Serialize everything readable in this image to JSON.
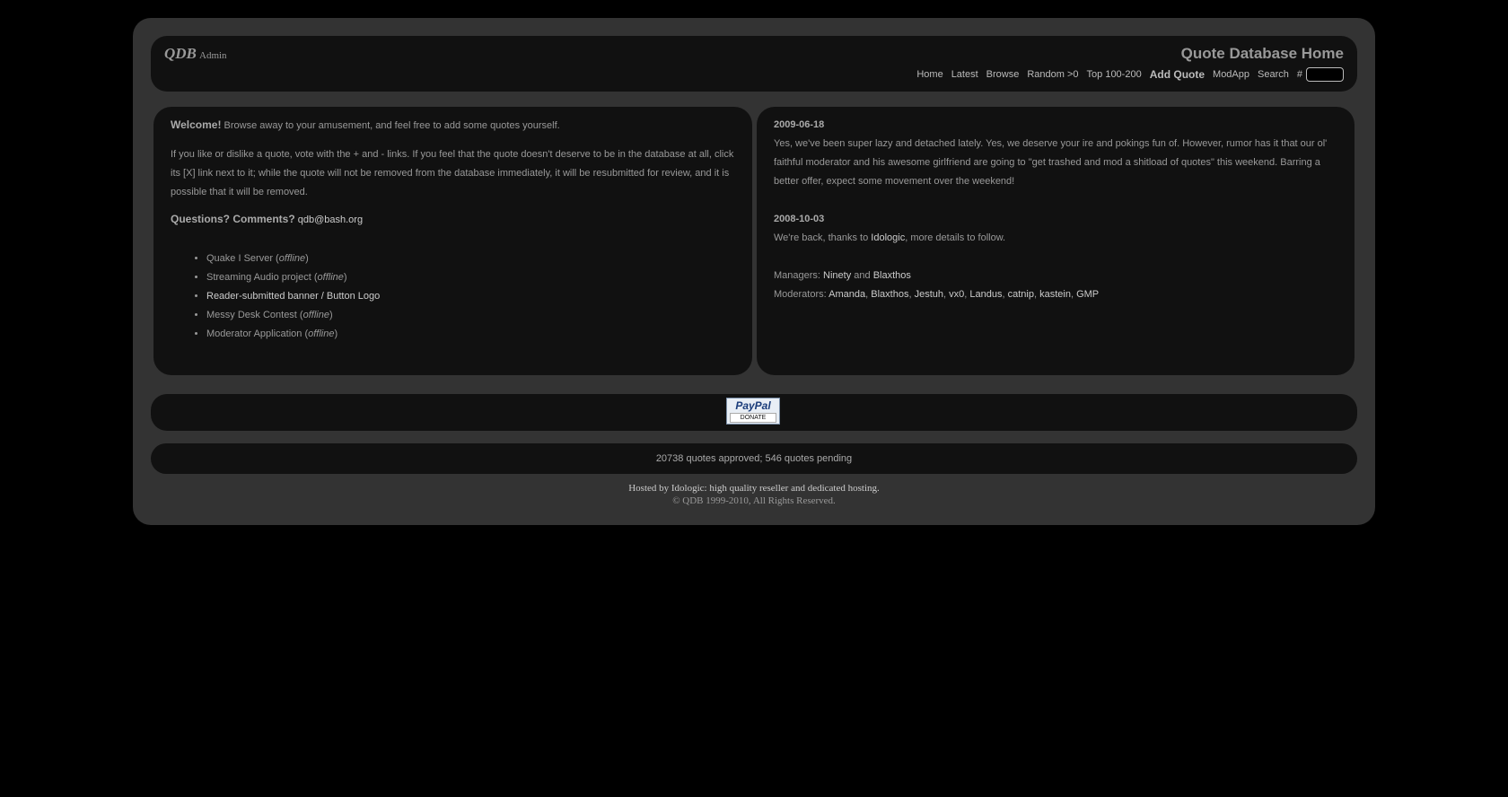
{
  "header": {
    "logo": "QDB",
    "logo_sub": "Admin",
    "title": "Quote Database Home",
    "nav": [
      {
        "label": "Home",
        "bold": false
      },
      {
        "label": "Latest",
        "bold": false
      },
      {
        "label": "Browse",
        "bold": false
      },
      {
        "label": "Random >0",
        "bold": false
      },
      {
        "label": "Top 100-200",
        "bold": false
      },
      {
        "label": "Add Quote",
        "bold": true
      },
      {
        "label": "ModApp",
        "bold": false
      },
      {
        "label": "Search",
        "bold": false
      }
    ],
    "hash_label": "#",
    "hash_input_value": ""
  },
  "welcome": {
    "heading": "Welcome!",
    "intro": " Browse away to your amusement, and feel free to add some quotes yourself.",
    "vote_text": "If you like or dislike a quote, vote with the + and - links. If you feel that the quote doesn't deserve to be in the database at all, click its [X] link next to it; while the quote will not be removed from the database immediately, it will be resubmitted for review, and it is possible that it will be removed.",
    "questions_label": "Questions? Comments?",
    "email": "qdb@bash.org",
    "links": [
      {
        "text": "Quake I Server (",
        "em": "offline",
        "close": ")",
        "link": false
      },
      {
        "text": "Streaming Audio project (",
        "em": "offline",
        "close": ")",
        "link": false
      },
      {
        "text": "Reader-submitted banner / Button Logo",
        "em": "",
        "close": "",
        "link": true
      },
      {
        "text": "Messy Desk Contest (",
        "em": "offline",
        "close": ")",
        "link": false
      },
      {
        "text": "Moderator Application (",
        "em": "offline",
        "close": ")",
        "link": false
      }
    ]
  },
  "news": [
    {
      "date": "2009-06-18",
      "body": "Yes, we've been super lazy and detached lately. Yes, we deserve your ire and pokings fun of. However, rumor has it that our ol' faithful moderator and his awesome girlfriend are going to \"get trashed and mod a shitload of quotes\" this weekend. Barring a better offer, expect some movement over the weekend!"
    },
    {
      "date": "2008-10-03",
      "body_pre": "We're back, thanks to ",
      "body_link": "Idologic",
      "body_post": ", more details to follow."
    }
  ],
  "staff": {
    "managers_label": "Managers:",
    "managers": [
      "Ninety",
      "Blaxthos"
    ],
    "managers_sep": "and",
    "moderators_label": "Moderators:",
    "moderators": [
      "Amanda",
      "Blaxthos",
      "Jestuh",
      "vx0",
      "Landus",
      "catnip",
      "kastein",
      "GMP"
    ]
  },
  "paypal": {
    "logo": "PayPal",
    "label": "DONATE"
  },
  "stats": "20738 quotes approved; 546 quotes pending",
  "footer": {
    "hosted": "Hosted by Idologic: high quality reseller and dedicated hosting.",
    "copyright": "© QDB 1999-2010, All Rights Reserved."
  },
  "colors": {
    "page_bg": "#000000",
    "frame_bg": "#333333",
    "panel_bg": "#111111",
    "text": "#999999",
    "link": "#cccccc"
  }
}
